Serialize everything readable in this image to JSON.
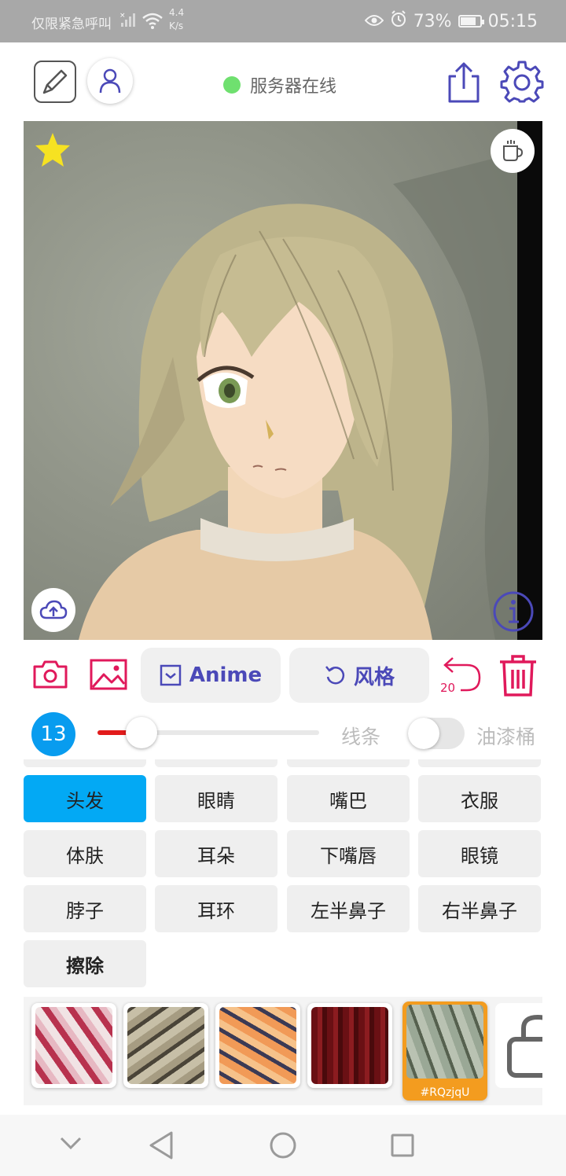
{
  "status_bar": {
    "emergency_text": "仅限紧急呼叫",
    "net_speed_value": "4.4",
    "net_speed_unit": "K/s",
    "battery": "73%",
    "battery_level": 0.73,
    "time": "05:15"
  },
  "toolbar": {
    "server_status": "服务器在线",
    "server_status_color": "#6fe06f"
  },
  "canvas": {
    "star_color": "#f6e222"
  },
  "actions": {
    "anime_label": "Anime",
    "style_label": "风格",
    "undo_count": "20",
    "accent_color": "#e0195b"
  },
  "brush": {
    "size": "13",
    "slider_level": 0.2,
    "line_label": "线条",
    "bucket_label": "油漆桶"
  },
  "parts": [
    {
      "label": "头发",
      "active": true
    },
    {
      "label": "眼睛"
    },
    {
      "label": "嘴巴"
    },
    {
      "label": "衣服"
    },
    {
      "label": "体肤"
    },
    {
      "label": "耳朵"
    },
    {
      "label": "下嘴唇"
    },
    {
      "label": "眼镜"
    },
    {
      "label": "脖子"
    },
    {
      "label": "耳环"
    },
    {
      "label": "左半鼻子"
    },
    {
      "label": "右半鼻子"
    },
    {
      "label": "擦除",
      "bold": true
    }
  ],
  "textures": {
    "selected_caption": "#RQzjqU"
  }
}
